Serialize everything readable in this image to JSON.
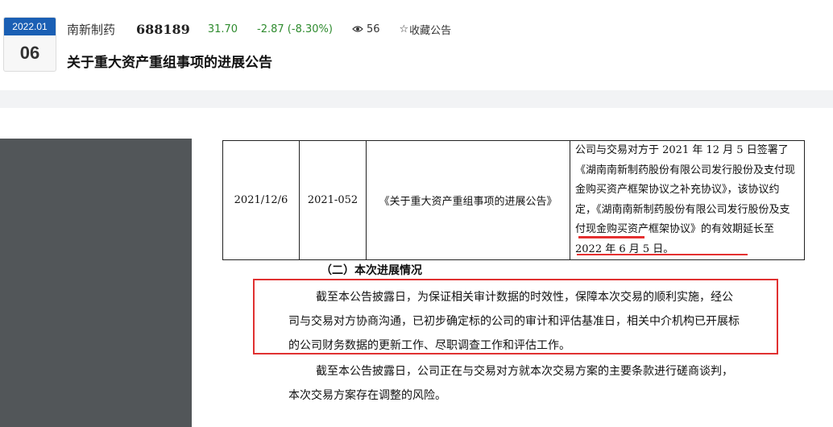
{
  "header": {
    "date_ym": "2022.01",
    "date_day": "06",
    "stock_name": "南新制药",
    "stock_code": "688189",
    "price": "31.70",
    "change": "-2.87 (-8.30%)",
    "views": "56",
    "favorite_label": "收藏公告",
    "title": "关于重大资产重组事项的进展公告"
  },
  "colors": {
    "date_badge": "#1a5fb4",
    "price_change": "#2e8b2e",
    "annotation_red": "#e53030",
    "viewer_sidebar": "#525659"
  },
  "doc": {
    "table_row": {
      "date": "2021/12/6",
      "number": "2021-052",
      "title": "《关于重大资产重组事项的进展公告》",
      "content": "公司与交易对方于 2021 年 12 月 5 日签署了《湖南南新制药股份有限公司发行股份及支付现金购买资产框架协议之补充协议》，该协议约定，《湖南南新制药股份有限公司发行股份及支付现金购买资产框架协议》的有效期延长至 2022 年 6 月 5 日。"
    },
    "section_title": "（二）本次进展情况",
    "para1": "截至本公告披露日，为保证相关审计数据的时效性，保障本次交易的顺利实施，经公司与交易对方协商沟通，已初步确定标的公司的审计和评估基准日，相关中介机构已开展标的公司财务数据的更新工作、尽职调查工作和评估工作。",
    "para2": "截至本公告披露日，公司正在与交易对方就本次交易方案的主要条款进行磋商谈判，本次交易方案存在调整的风险。"
  }
}
